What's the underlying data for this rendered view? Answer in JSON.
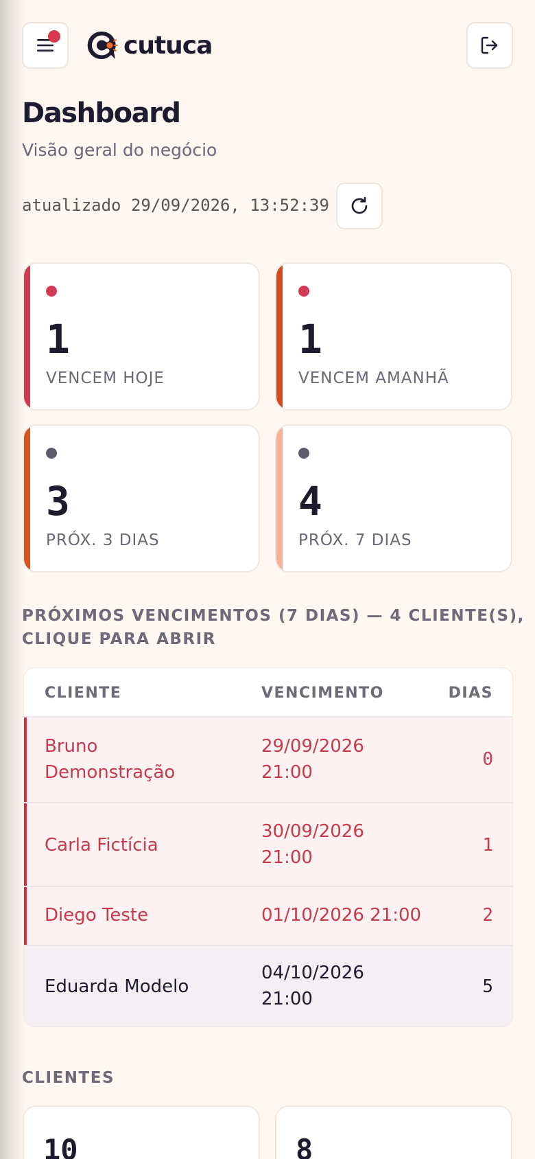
{
  "brand": {
    "name": "cutuca",
    "accent": "#f26a2e",
    "notify_color": "#d9394f"
  },
  "header": {
    "menu_icon": "hamburger-icon",
    "logout_icon": "logout-icon"
  },
  "page": {
    "title": "Dashboard",
    "subtitle": "Visão geral do negócio",
    "updated_text": "atualizado 29/09/2026, 13:52:39",
    "refresh_icon": "refresh-icon"
  },
  "stats": [
    {
      "value": "1",
      "label": "VENCEM HOJE",
      "bar_color": "#d03a52",
      "dot_color": "#d03a52"
    },
    {
      "value": "1",
      "label": "VENCEM AMANHÃ",
      "bar_color": "#d64a1c",
      "dot_color": "#d03a52"
    },
    {
      "value": "3",
      "label": "PRÓX. 3 DIAS",
      "bar_color": "#d9521c",
      "dot_color": "#5e5b6a"
    },
    {
      "value": "4",
      "label": "PRÓX. 7 DIAS",
      "bar_color": "#f6b095",
      "dot_color": "#5e5b6a"
    }
  ],
  "upcoming": {
    "heading_line1": "PRÓXIMOS VENCIMENTOS (7 DIAS) — 4 CLIENTE(S),",
    "heading_line2": "CLIQUE PARA ABRIR",
    "columns": {
      "client": "CLIENTE",
      "due": "VENCIMENTO",
      "days": "DIAS"
    },
    "rows": [
      {
        "name_l1": "Bruno",
        "name_l2": "Demonstração",
        "date_l1": "29/09/2026",
        "date_l2": "21:00",
        "days": "0"
      },
      {
        "name_l1": "Carla Fictícia",
        "name_l2": "",
        "date_l1": "30/09/2026",
        "date_l2": "21:00",
        "days": "1"
      },
      {
        "name_l1": "Diego Teste",
        "name_l2": "",
        "date_l1": "01/10/2026 21:00",
        "date_l2": "",
        "days": "2"
      },
      {
        "name_l1": "Eduarda Modelo",
        "name_l2": "",
        "date_l1": "04/10/2026",
        "date_l2": "21:00",
        "days": "5"
      }
    ]
  },
  "clients": {
    "heading": "CLIENTES",
    "cards": [
      {
        "value": "10"
      },
      {
        "value": "8"
      }
    ]
  }
}
